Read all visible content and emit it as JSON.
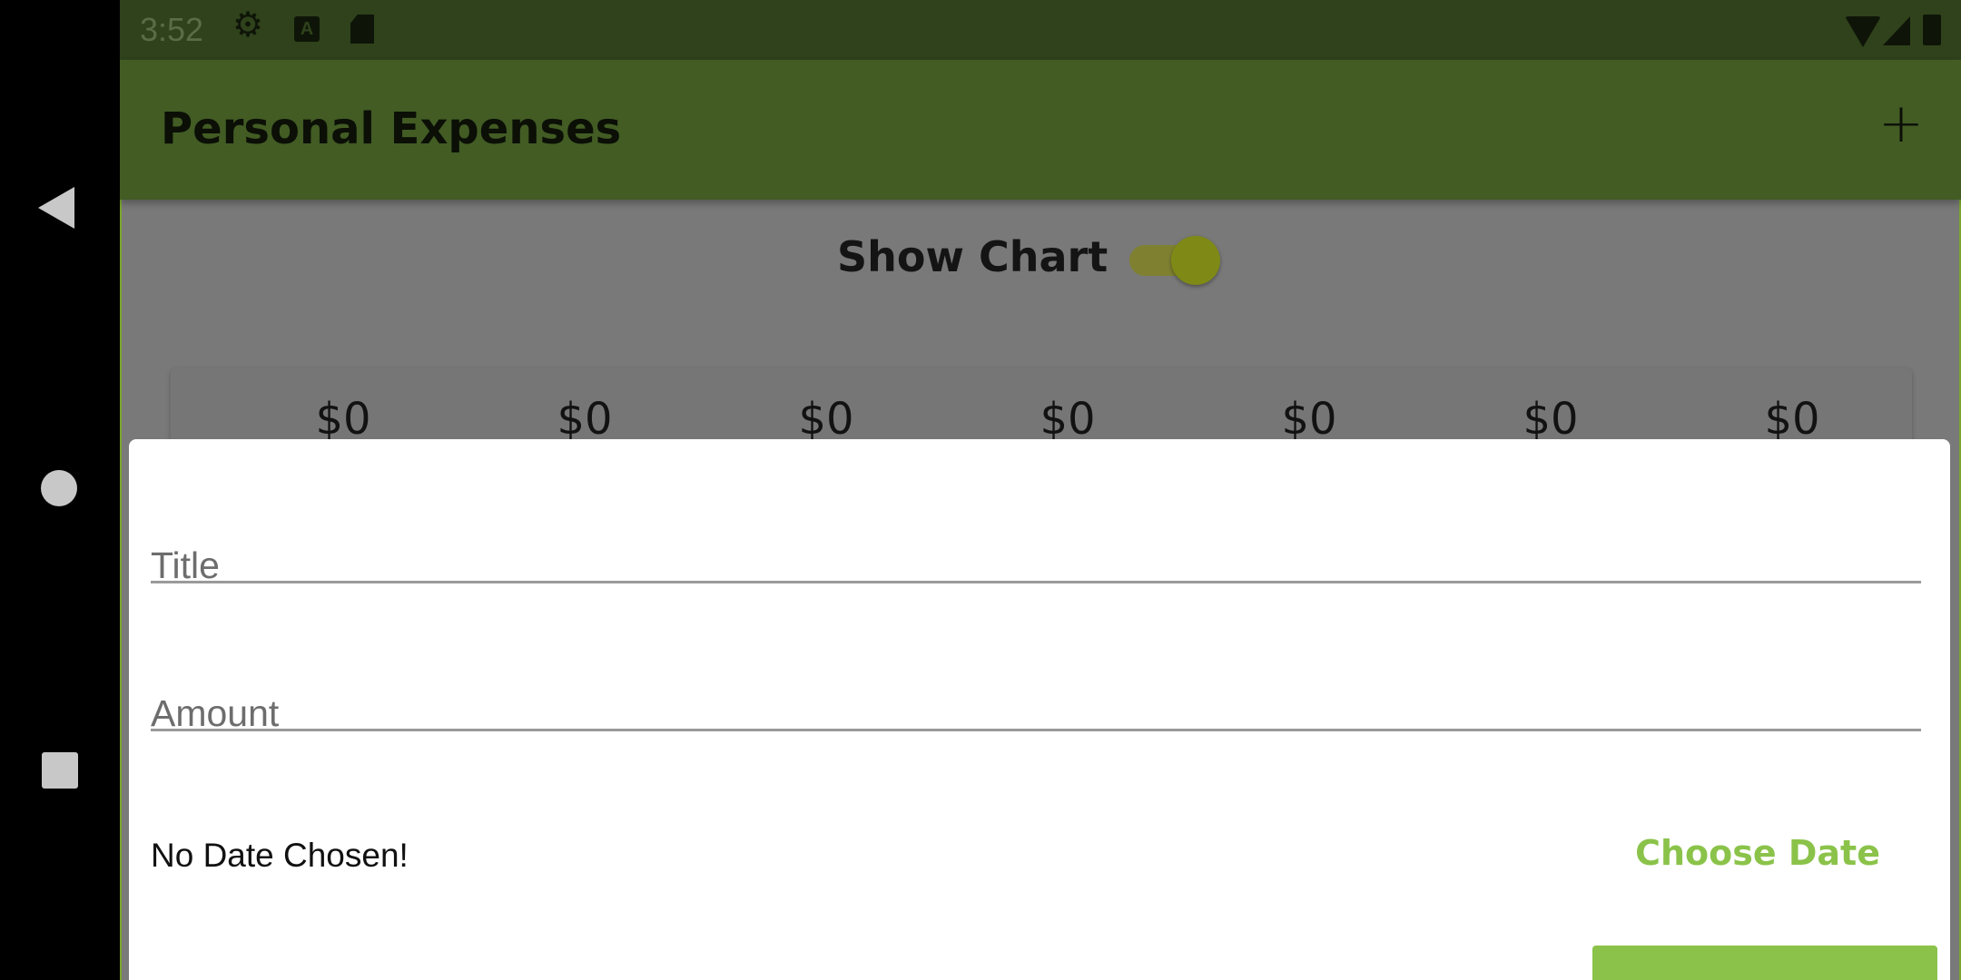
{
  "status_bar": {
    "time": "3:52",
    "icons": [
      "gear-icon",
      "a-badge-icon",
      "sd-card-icon",
      "wifi-icon",
      "signal-icon",
      "battery-icon"
    ]
  },
  "app_bar": {
    "title": "Personal Expenses",
    "add_icon": "+"
  },
  "chart_toggle": {
    "label": "Show Chart",
    "on": true
  },
  "chart": {
    "values": [
      "$0",
      "$0",
      "$0",
      "$0",
      "$0",
      "$0",
      "$0"
    ]
  },
  "form": {
    "title_placeholder": "Title",
    "amount_placeholder": "Amount",
    "date_text": "No Date Chosen!",
    "choose_date_label": "Choose Date"
  },
  "colors": {
    "app_bar": "#425c24",
    "accent": "#8bc34a",
    "status_bar": "#2f421b"
  },
  "nav_bar": {
    "icons": [
      "back-icon",
      "home-icon",
      "recents-icon"
    ]
  }
}
